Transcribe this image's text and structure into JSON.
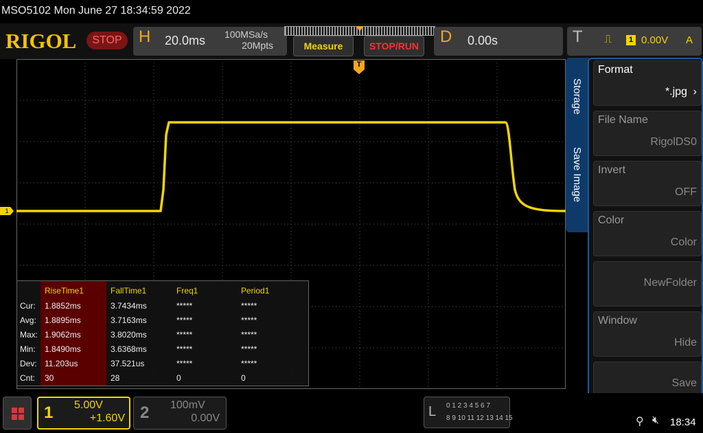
{
  "status": {
    "text": "MSO5102  Mon June 27 18:34:59 2022"
  },
  "header": {
    "logo": "RIGOL",
    "run_state": "STOP",
    "horizontal": {
      "letter": "H",
      "scale": "20.0ms",
      "sample_rate": "100MSa/s",
      "memory_depth": "20Mpts"
    },
    "measure_label": "Measure",
    "stoprun_label": "STOP/RUN",
    "delay": {
      "letter": "D",
      "value": "0.00s"
    },
    "trigger": {
      "letter": "T",
      "channel": "1",
      "level": "0.00V",
      "mode": "A"
    }
  },
  "markers": {
    "ch1": "1",
    "trigger": "T"
  },
  "waveform": {
    "color": "#f2d500"
  },
  "measurements": {
    "columns": [
      "RiseTime1",
      "FallTime1",
      "Freq1",
      "Period1"
    ],
    "rows": [
      {
        "label": "Cur:",
        "values": [
          "1.8852ms",
          "3.7434ms",
          "*****",
          "*****"
        ]
      },
      {
        "label": "Avg:",
        "values": [
          "1.8895ms",
          "3.7163ms",
          "*****",
          "*****"
        ]
      },
      {
        "label": "Max:",
        "values": [
          "1.9062ms",
          "3.8020ms",
          "*****",
          "*****"
        ]
      },
      {
        "label": "Min:",
        "values": [
          "1.8490ms",
          "3.6368ms",
          "*****",
          "*****"
        ]
      },
      {
        "label": "Dev:",
        "values": [
          "11.203us",
          "37.521us",
          "*****",
          "*****"
        ]
      },
      {
        "label": "Cnt:",
        "values": [
          "30",
          "28",
          "0",
          "0"
        ]
      }
    ]
  },
  "side_menu": {
    "tabs": [
      "Storage",
      "Save Image"
    ],
    "items": [
      {
        "title": "Format",
        "value": "*.jpg"
      },
      {
        "title": "File Name",
        "value": "RigolDS0"
      },
      {
        "title": "Invert",
        "value": "OFF"
      },
      {
        "title": "Color",
        "value": "Color"
      },
      {
        "title": "",
        "value": "NewFolder"
      },
      {
        "title": "Window",
        "value": "Hide"
      },
      {
        "title": "",
        "value": "Save"
      }
    ]
  },
  "footer": {
    "ch1": {
      "num": "1",
      "scale": "5.00V",
      "offset": "+1.60V"
    },
    "ch2": {
      "num": "2",
      "scale": "100mV",
      "offset": "0.00V"
    },
    "la": {
      "letter": "L",
      "row1": "0 1 2 3  4 5 6 7",
      "row2": "8 9 10 11 12 13 14 15"
    },
    "time": "18:34"
  }
}
